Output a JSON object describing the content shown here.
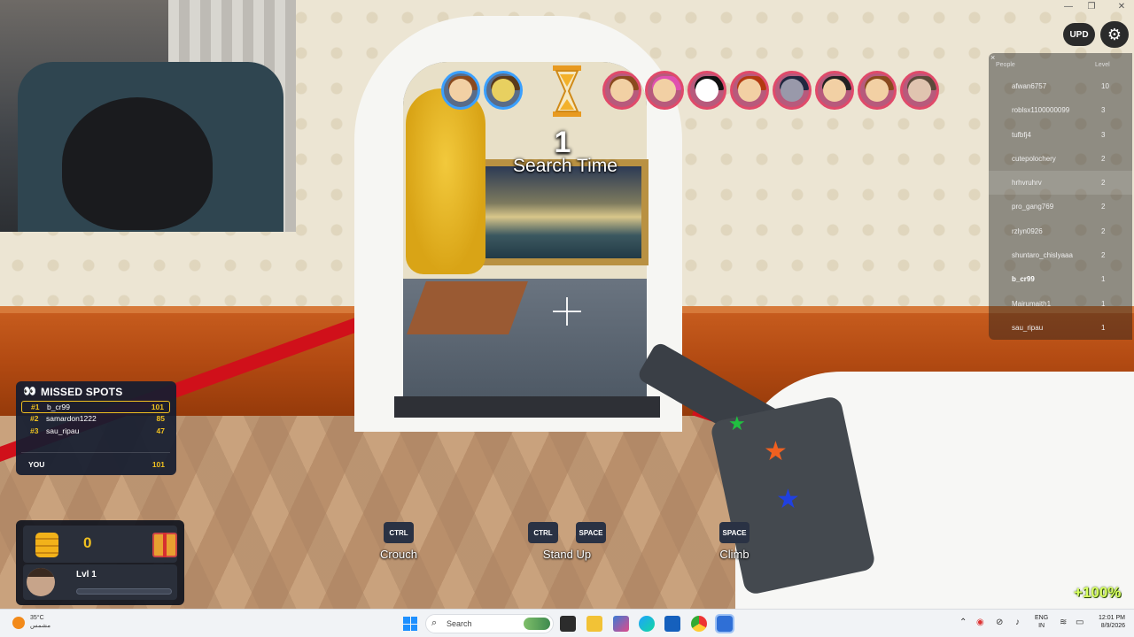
{
  "round": {
    "number": "1",
    "phase": "Search Time"
  },
  "top_buttons": {
    "upd_label": "UPD",
    "settings_icon": "gear-icon"
  },
  "leaderboard": {
    "close_label": "×",
    "headers": {
      "name": "People",
      "value": "Level"
    },
    "rows": [
      {
        "name": "afwan6757",
        "level": "10"
      },
      {
        "name": "roblsx1100000099",
        "level": "3"
      },
      {
        "name": "tufbfj4",
        "level": "3"
      },
      {
        "name": "cutepolochery",
        "level": "2"
      },
      {
        "name": "hrhvruhrv",
        "level": "2"
      },
      {
        "name": "pro_gang769",
        "level": "2"
      },
      {
        "name": "rzlyn0926",
        "level": "2"
      },
      {
        "name": "shuntaro_chislyaaa",
        "level": "2"
      },
      {
        "name": "b_cr99",
        "level": "1"
      },
      {
        "name": "Mairumaith1",
        "level": "1"
      },
      {
        "name": "sau_ripau",
        "level": "1"
      }
    ]
  },
  "missed_spots": {
    "title": "MISSED SPOTS",
    "rows": [
      {
        "rank": "#1",
        "name": "b_cr99",
        "score": "101"
      },
      {
        "rank": "#2",
        "name": "samardon1222",
        "score": "85"
      },
      {
        "rank": "#3",
        "name": "sau_ripau",
        "score": "47"
      }
    ],
    "you_label": "YOU",
    "you_score": "101"
  },
  "stats": {
    "coins": "0",
    "level_label": "Lvl 1",
    "level_progress": 0.0
  },
  "controls": [
    {
      "keys": [
        "CTRL"
      ],
      "label": "Crouch"
    },
    {
      "keys": [
        "CTRL",
        "SPACE"
      ],
      "label": "Stand Up"
    },
    {
      "keys": [
        "SPACE"
      ],
      "label": "Climb"
    }
  ],
  "boost": "+100%",
  "taskbar": {
    "weather_temp": "35°C",
    "weather_desc": "مشمس",
    "search_placeholder": "Search",
    "lang_top": "ENG",
    "lang_bottom": "IN",
    "time": "12:01 PM",
    "date": "8/9/2026"
  },
  "colors": {
    "accent_gold": "#f0c020",
    "panel_bg": "#141c30",
    "player_ring_blue": "#3aa0ff",
    "player_ring_red": "#e04a6a"
  }
}
